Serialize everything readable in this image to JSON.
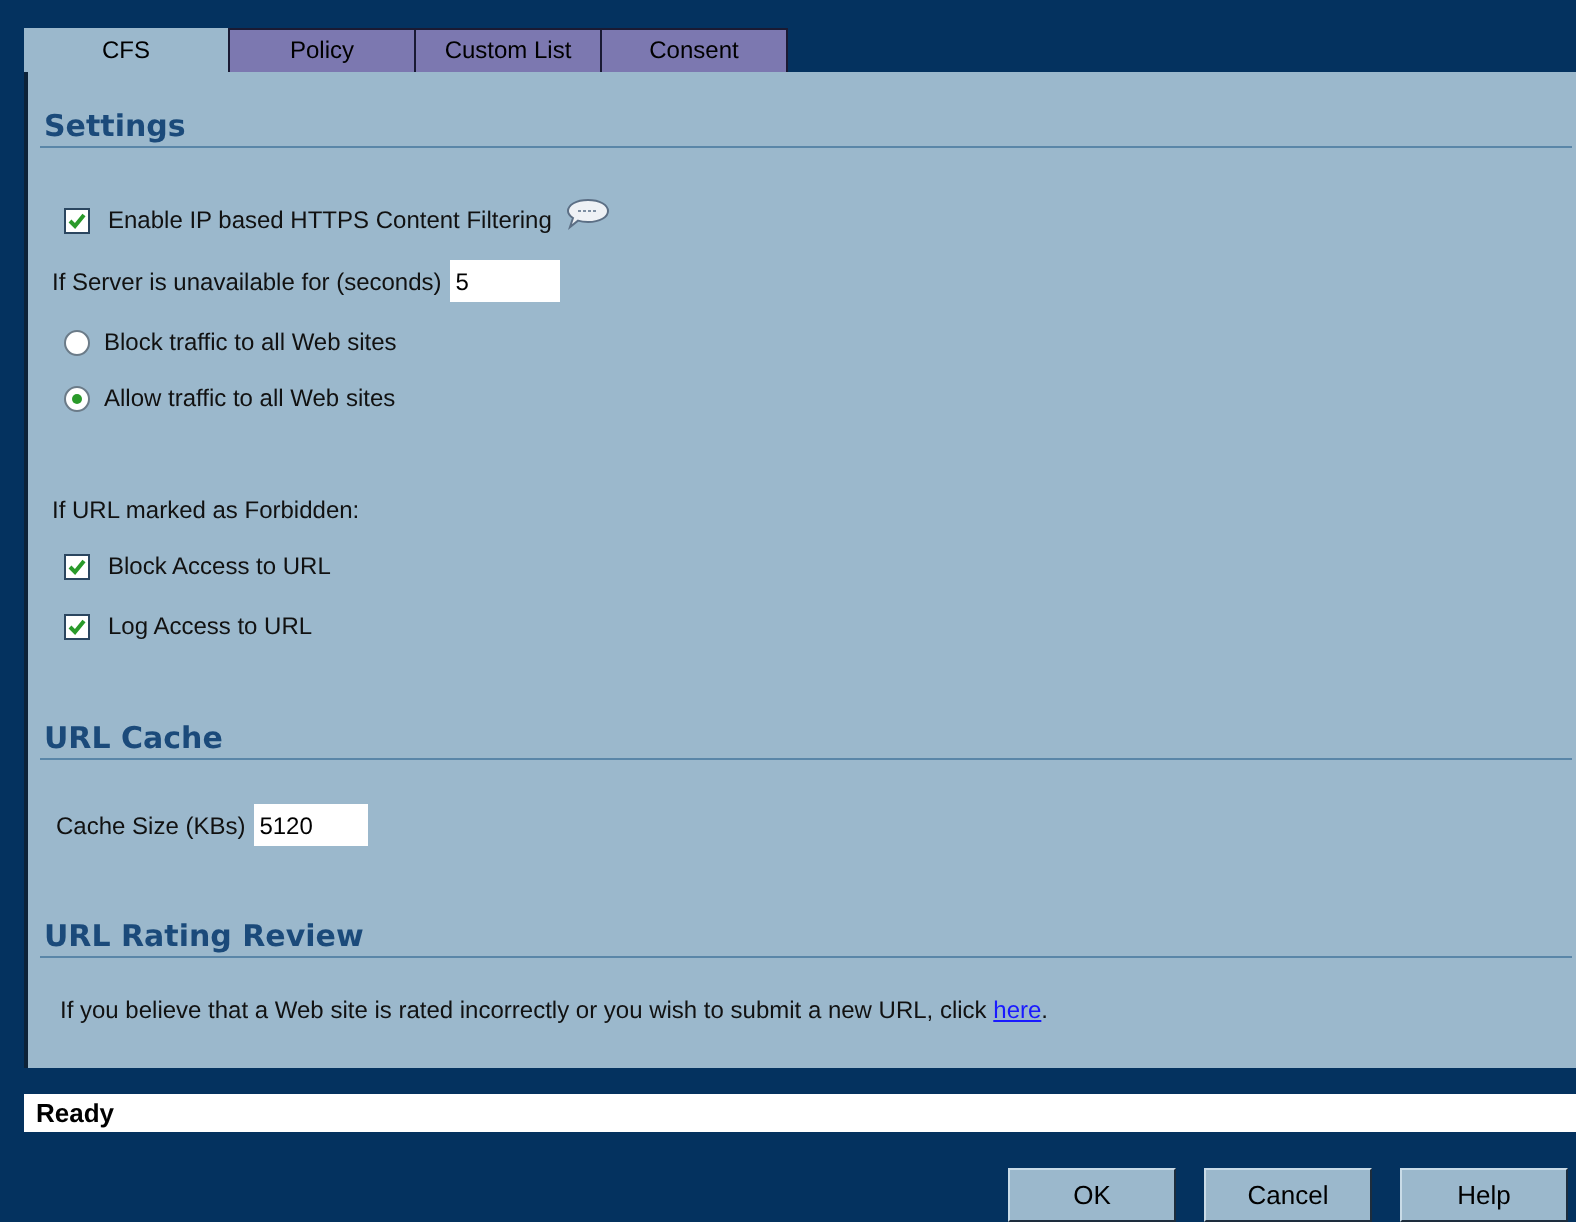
{
  "tabs": [
    {
      "label": "CFS",
      "selected": true
    },
    {
      "label": "Policy",
      "selected": false
    },
    {
      "label": "Custom List",
      "selected": false
    },
    {
      "label": "Consent",
      "selected": false
    }
  ],
  "settings": {
    "heading": "Settings",
    "https_filtering": {
      "label": "Enable IP based HTTPS Content Filtering",
      "checked": true
    },
    "server_unavailable": {
      "label": "If Server is unavailable for (seconds)",
      "value": "5"
    },
    "options": [
      {
        "label": "Block traffic to all Web sites",
        "selected": false
      },
      {
        "label": "Allow traffic to all Web sites",
        "selected": true
      }
    ],
    "forbidden": {
      "label": "If URL marked as Forbidden:",
      "items": [
        {
          "label": "Block Access to URL",
          "checked": true
        },
        {
          "label": "Log Access to URL",
          "checked": true
        }
      ]
    }
  },
  "url_cache": {
    "heading": "URL Cache",
    "label": "Cache Size (KBs)",
    "value": "5120"
  },
  "rating_review": {
    "heading": "URL Rating Review",
    "text": "If you believe that a Web site is rated incorrectly or you wish to submit a new URL, click ",
    "link": "here",
    "text_after": "."
  },
  "status_bar": "Ready",
  "buttons": [
    "OK",
    "Cancel",
    "Help"
  ]
}
